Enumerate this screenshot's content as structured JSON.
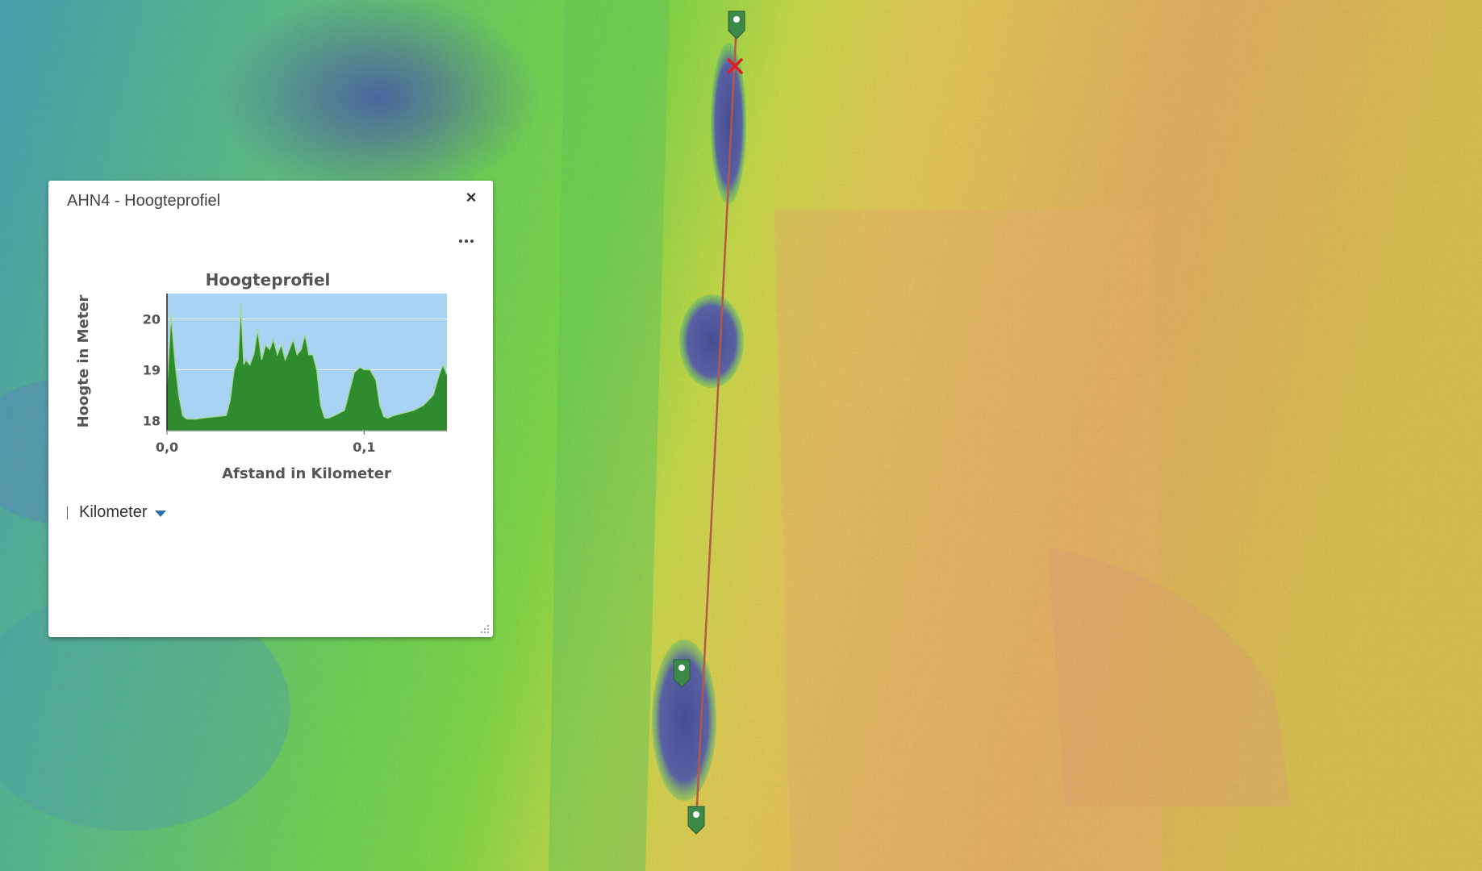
{
  "panel": {
    "title": "AHN4 - Hoogteprofiel",
    "close_label": "×",
    "more_icon": "ellipsis-icon",
    "unit_label": "Kilometer"
  },
  "chart_data": {
    "type": "area",
    "title": "Hoogteprofiel",
    "xlabel": "Afstand in Kilometer",
    "ylabel": "Hoogte in Meter",
    "xlim": [
      0,
      0.142
    ],
    "ylim": [
      17.8,
      20.5
    ],
    "x_ticks": [
      "0,0",
      "0,1"
    ],
    "x_tick_values": [
      0,
      0.1
    ],
    "y_ticks": [
      "20",
      "19",
      "18"
    ],
    "y_tick_values": [
      20,
      19,
      18
    ],
    "colors": {
      "fill": "#2e8b2e",
      "line": "#a8d8a0",
      "background": "#a9d3f5"
    },
    "series": [
      {
        "x": [
          0,
          0.002,
          0.004,
          0.006,
          0.008,
          0.01,
          0.015,
          0.02,
          0.025,
          0.03,
          0.032,
          0.034,
          0.036,
          0.0375,
          0.039,
          0.04,
          0.042,
          0.044,
          0.046,
          0.048,
          0.05,
          0.052,
          0.054,
          0.056,
          0.058,
          0.06,
          0.062,
          0.064,
          0.066,
          0.068,
          0.07,
          0.072,
          0.074,
          0.076,
          0.078,
          0.08,
          0.082,
          0.085,
          0.09,
          0.095,
          0.098,
          0.1,
          0.103,
          0.106,
          0.108,
          0.11,
          0.112,
          0.115,
          0.12,
          0.125,
          0.13,
          0.135,
          0.138,
          0.14,
          0.142
        ],
        "y": [
          18.7,
          20.1,
          19.2,
          18.5,
          18.1,
          18.03,
          18.03,
          18.06,
          18.08,
          18.1,
          18.4,
          19.0,
          19.2,
          20.3,
          19.1,
          19.2,
          19.1,
          19.3,
          19.8,
          19.2,
          19.5,
          19.4,
          19.6,
          19.3,
          19.5,
          19.2,
          19.4,
          19.6,
          19.3,
          19.4,
          19.7,
          19.3,
          19.3,
          19.0,
          18.3,
          18.05,
          18.05,
          18.1,
          18.2,
          18.95,
          19.05,
          19.0,
          19.0,
          18.8,
          18.3,
          18.08,
          18.05,
          18.1,
          18.15,
          18.2,
          18.3,
          18.5,
          18.9,
          19.1,
          18.9
        ]
      }
    ]
  }
}
